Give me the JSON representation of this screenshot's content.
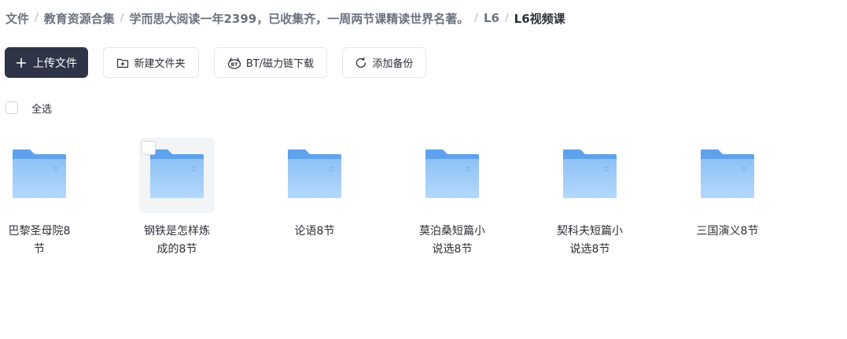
{
  "breadcrumb": [
    {
      "label": "文件"
    },
    {
      "label": "教育资源合集"
    },
    {
      "label": "学而思大阅读一年2399，已收集齐，一周两节课精读世界名著。"
    },
    {
      "label": "L6"
    },
    {
      "label": "L6视频课"
    }
  ],
  "toolbar": {
    "upload": {
      "label": "上传文件",
      "icon": "plus-icon"
    },
    "new_folder": {
      "label": "新建文件夹",
      "icon": "folder-plus-icon"
    },
    "bt_download": {
      "label": "BT/磁力链下载",
      "icon": "bt-icon"
    },
    "backup": {
      "label": "添加备份",
      "icon": "refresh-icon"
    }
  },
  "select_all": {
    "label": "全选",
    "checked": false
  },
  "folders": [
    {
      "name_line1": "巴黎圣母院8",
      "name_line2": "节"
    },
    {
      "name_line1": "钢铁是怎样炼",
      "name_line2": "成的8节",
      "hovered": true
    },
    {
      "name_line1": "论语8节",
      "name_line2": ""
    },
    {
      "name_line1": "莫泊桑短篇小",
      "name_line2": "说选8节"
    },
    {
      "name_line1": "契科夫短篇小",
      "name_line2": "说选8节"
    },
    {
      "name_line1": "三国演义8节",
      "name_line2": ""
    }
  ],
  "colors": {
    "primary_button": "#2f3447",
    "folder_back": "#5ea2ee",
    "folder_front_top": "#8fc1f5",
    "folder_front_bottom": "#aad2fb"
  }
}
